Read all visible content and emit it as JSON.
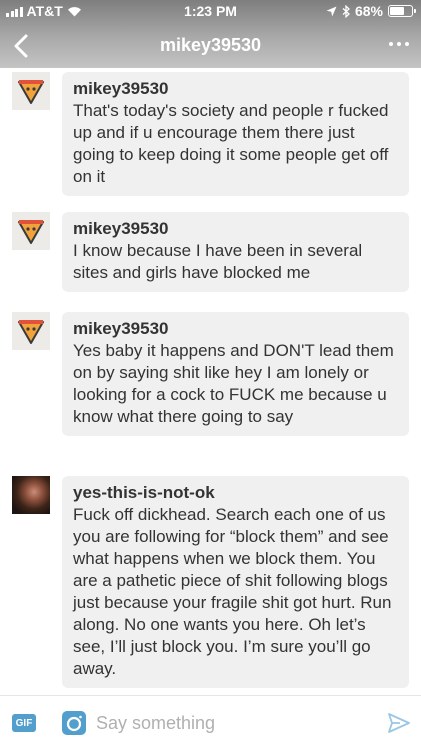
{
  "status": {
    "carrier": "AT&T",
    "time": "1:23 PM",
    "battery": "68%",
    "battery_level": 0.68
  },
  "nav": {
    "title": "mikey39530"
  },
  "messages": [
    {
      "sender": "mikey39530",
      "text": "That's today's society and people r fucked up and if u encourage them there just going to keep doing it some people get off on it",
      "avatar": "pizza-slice-avatar"
    },
    {
      "sender": "mikey39530",
      "text": "I  know because I have been in several sites and girls have blocked me",
      "avatar": "pizza-slice-avatar"
    },
    {
      "sender": "mikey39530",
      "text": "Yes baby it happens and DON'T lead them on by saying shit like hey I am lonely or looking for a cock to FUCK me because u know what there going to say",
      "avatar": "pizza-slice-avatar"
    },
    {
      "sender": "yes-this-is-not-ok",
      "text": "Fuck off dickhead. Search each one of us you are following for “block them” and see what happens when we block them. You are a pathetic piece of shit following blogs just because your fragile shit got hurt. Run along. No one wants you here. Oh let’s see, I’ll just block you. I’m sure you’ll go away.",
      "avatar": "photo-avatar"
    }
  ],
  "composer": {
    "gif_label": "GIF",
    "placeholder": "Say something"
  },
  "colors": {
    "accent": "#529ecc",
    "bubble": "#f0f0f0",
    "text": "#333333"
  }
}
